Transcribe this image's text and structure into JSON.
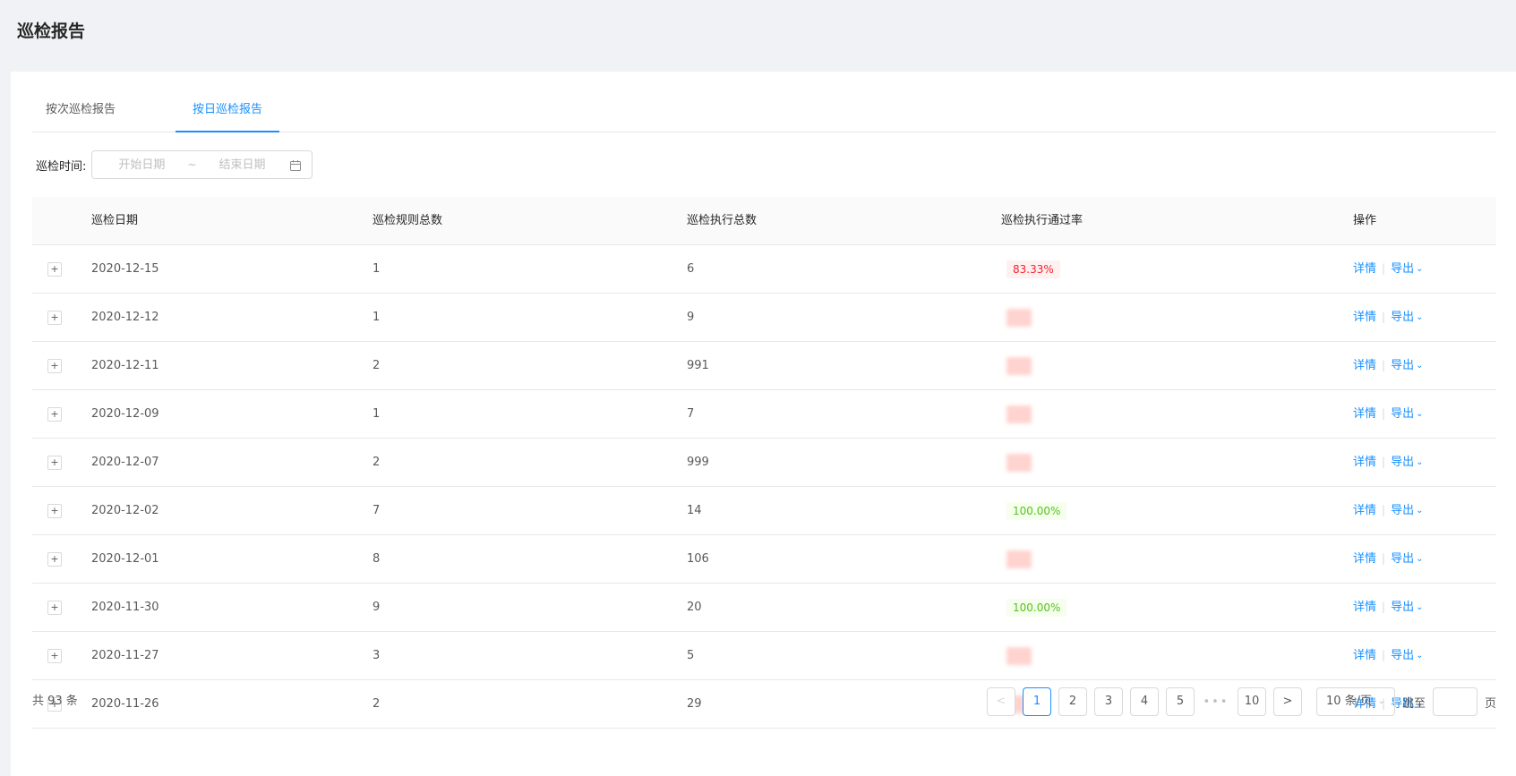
{
  "page_title": "巡检报告",
  "tabs": [
    {
      "label": "按次巡检报告",
      "active": false
    },
    {
      "label": "按日巡检报告",
      "active": true
    }
  ],
  "filter": {
    "label": "巡检时间:",
    "start_placeholder": "开始日期",
    "separator": "~",
    "end_placeholder": "结束日期",
    "icon": "calendar-icon"
  },
  "table": {
    "columns": [
      "巡检日期",
      "巡检规则总数",
      "巡检执行总数",
      "巡检执行通过率",
      "操作"
    ],
    "rows": [
      {
        "date": "2020-12-15",
        "rules": "1",
        "exec": "6",
        "rate": "83.33%",
        "rate_style": "red"
      },
      {
        "date": "2020-12-12",
        "rules": "1",
        "exec": "9",
        "rate": "",
        "rate_style": "blur"
      },
      {
        "date": "2020-12-11",
        "rules": "2",
        "exec": "991",
        "rate": "",
        "rate_style": "blur"
      },
      {
        "date": "2020-12-09",
        "rules": "1",
        "exec": "7",
        "rate": "",
        "rate_style": "blur"
      },
      {
        "date": "2020-12-07",
        "rules": "2",
        "exec": "999",
        "rate": "",
        "rate_style": "blur"
      },
      {
        "date": "2020-12-02",
        "rules": "7",
        "exec": "14",
        "rate": "100.00%",
        "rate_style": "green"
      },
      {
        "date": "2020-12-01",
        "rules": "8",
        "exec": "106",
        "rate": "",
        "rate_style": "blur"
      },
      {
        "date": "2020-11-30",
        "rules": "9",
        "exec": "20",
        "rate": "100.00%",
        "rate_style": "green"
      },
      {
        "date": "2020-11-27",
        "rules": "3",
        "exec": "5",
        "rate": "",
        "rate_style": "blur"
      },
      {
        "date": "2020-11-26",
        "rules": "2",
        "exec": "29",
        "rate": "",
        "rate_style": "blur"
      }
    ],
    "expand_symbol": "+",
    "detail_label": "详情",
    "export_label": "导出",
    "op_separator": "|"
  },
  "footer": {
    "total_text": "共 93 条",
    "pages": [
      "1",
      "2",
      "3",
      "4",
      "5"
    ],
    "current_page": "1",
    "ellipsis": "•••",
    "last_page": "10",
    "prev_symbol": "<",
    "next_symbol": ">",
    "page_size": "10 条/页",
    "jump_label": "跳至",
    "jump_suffix": "页"
  },
  "colors": {
    "primary": "#1890ff",
    "danger": "#f5222d",
    "success": "#52c41a",
    "background": "#f0f2f5"
  }
}
